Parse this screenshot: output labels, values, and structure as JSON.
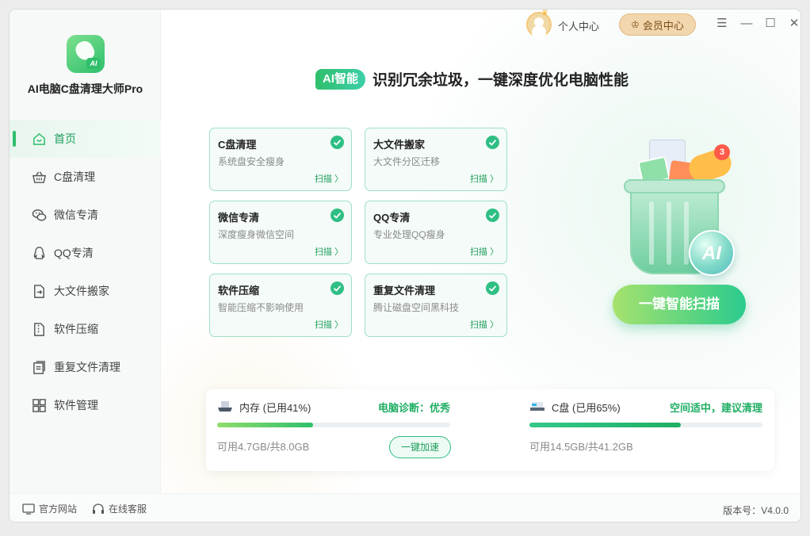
{
  "app": {
    "title": "AI电脑C盘清理大师Pro",
    "logo_badge": "AI"
  },
  "sidebar": {
    "items": [
      {
        "label": "首页",
        "icon": "home-icon",
        "active": true
      },
      {
        "label": "C盘清理",
        "icon": "basket-icon"
      },
      {
        "label": "微信专清",
        "icon": "wechat-icon"
      },
      {
        "label": "QQ专清",
        "icon": "qq-icon"
      },
      {
        "label": "大文件搬家",
        "icon": "file-move-icon"
      },
      {
        "label": "软件压缩",
        "icon": "zip-icon"
      },
      {
        "label": "重复文件清理",
        "icon": "duplicate-file-icon"
      },
      {
        "label": "软件管理",
        "icon": "apps-grid-icon"
      }
    ]
  },
  "topbar": {
    "personal_label": "个人中心",
    "vip_label": "会员中心",
    "icons": [
      "avatar",
      "crown-icon",
      "menu-icon",
      "minimize-icon",
      "maximize-icon",
      "close-icon"
    ]
  },
  "headline": {
    "badge": "AI智能",
    "text": "识别冗余垃圾，一键深度优化电脑性能"
  },
  "cards": [
    {
      "title": "C盘清理",
      "desc": "系统盘安全瘦身",
      "action": "扫描 〉"
    },
    {
      "title": "大文件搬家",
      "desc": "大文件分区迁移",
      "action": "扫描 〉"
    },
    {
      "title": "微信专清",
      "desc": "深度瘦身微信空间",
      "action": "扫描 〉"
    },
    {
      "title": "QQ专清",
      "desc": "专业处理QQ瘦身",
      "action": "扫描 〉"
    },
    {
      "title": "软件压缩",
      "desc": "智能压缩不影响使用",
      "action": "扫描 〉"
    },
    {
      "title": "重复文件清理",
      "desc": "腾让磁盘空间黑科技",
      "action": "扫描 〉"
    }
  ],
  "illustration": {
    "badge_count": "3",
    "orb_label": "AI"
  },
  "scan_button": "一键智能扫描",
  "status": {
    "memory": {
      "name": "内存 (已用41%)",
      "used_percent": 41,
      "evaluation": "电脑诊断：优秀",
      "free": "可用4.7GB/共8.0GB",
      "button": "一键加速"
    },
    "disk": {
      "name": "C盘 (已用65%)",
      "used_percent": 65,
      "evaluation": "空间适中，建议清理",
      "free": "可用14.5GB/共41.2GB"
    }
  },
  "footer": {
    "website": "官方网站",
    "support": "在线客服",
    "version": "版本号：V4.0.0"
  },
  "colors": {
    "accent": "#2fbf6c",
    "accent_dark": "#1f9e5c",
    "vip_bg": "#f2d6ae"
  }
}
